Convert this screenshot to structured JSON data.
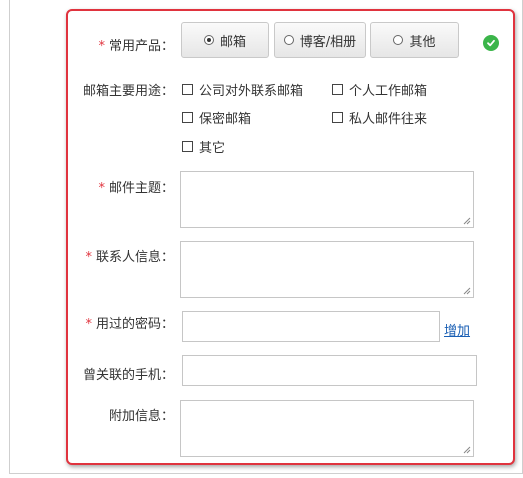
{
  "form": {
    "common_product": {
      "label": "常用产品：",
      "options": [
        "邮箱",
        "博客/相册",
        "其他"
      ],
      "selected": "邮箱"
    },
    "mailbox_usage": {
      "label": "邮箱主要用途：",
      "options": [
        "公司对外联系邮箱",
        "个人工作邮箱",
        "保密邮箱",
        "私人邮件往来",
        "其它"
      ]
    },
    "mail_subject": {
      "label": "邮件主题："
    },
    "contact_info": {
      "label": "联系人信息："
    },
    "used_password": {
      "label": "用过的密码：",
      "add_link": "增加"
    },
    "linked_phone": {
      "label": "曾关联的手机："
    },
    "extra_info": {
      "label": "附加信息："
    },
    "required_mark": "*"
  },
  "colors": {
    "required": "#e0333e",
    "panel_border": "#e0333e",
    "success": "#3bb54a",
    "link": "#1a5fb4"
  },
  "icons": {
    "validation": "check-circle-icon"
  }
}
